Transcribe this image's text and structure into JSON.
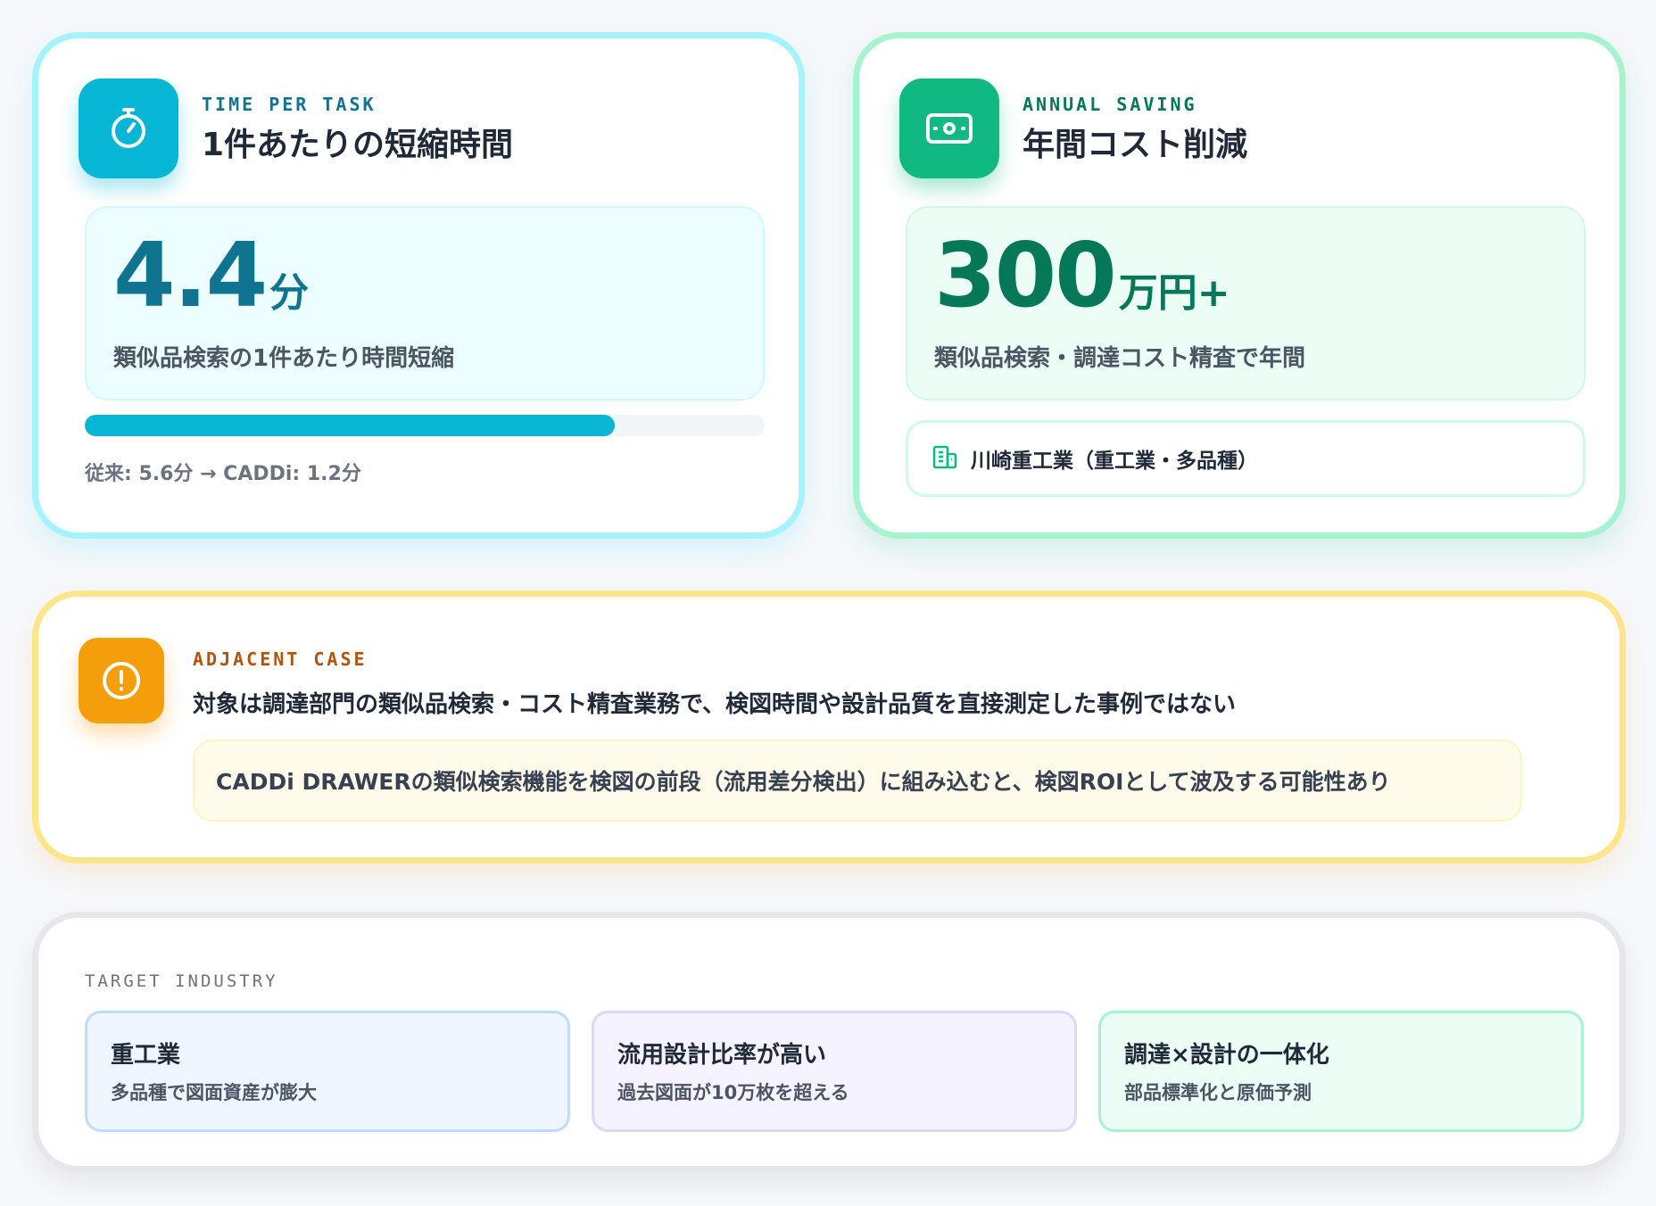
{
  "time_card": {
    "icon": "stopwatch-icon",
    "eyebrow": "TIME PER TASK",
    "title": "1件あたりの短縮時間",
    "value": "4.4",
    "unit": "分",
    "caption": "類似品検索の1件あたり時間短縮",
    "progress": 0.78,
    "note": "従来: 5.6分 → CADDi: 1.2分",
    "accent": "#06b6d4",
    "value_color": "#0e7490"
  },
  "saving_card": {
    "icon": "banknote-icon",
    "eyebrow": "ANNUAL SAVING",
    "title": "年間コスト削減",
    "value": "300",
    "unit": "万円+",
    "caption": "類似品検索・調達コスト精査で年間",
    "company_icon": "building-icon",
    "company": "川崎重工業（重工業・多品種）",
    "accent": "#10b981",
    "value_color": "#047857"
  },
  "adjacent_card": {
    "icon": "alert-circle-icon",
    "eyebrow": "ADJACENT CASE",
    "title": "対象は調達部門の類似品検索・コスト精査業務で、検図時間や設計品質を直接測定した事例ではない",
    "note": "CADDi DRAWERの類似検索機能を検図の前段（流用差分検出）に組み込むと、検図ROIとして波及する可能性あり",
    "accent": "#f59e0b",
    "eyebrow_color": "#b45309"
  },
  "target_card": {
    "label": "TARGET INDUSTRY",
    "items": [
      {
        "title": "重工業",
        "sub": "多品種で図面資産が膨大",
        "bg": "#eff6ff",
        "border": "#bfdbfe"
      },
      {
        "title": "流用設計比率が高い",
        "sub": "過去図面が10万枚を超える",
        "bg": "#f5f3ff",
        "border": "#ddd6fe"
      },
      {
        "title": "調達×設計の一体化",
        "sub": "部品標準化と原価予測",
        "bg": "#ecfdf5",
        "border": "#a7f3d0"
      }
    ]
  }
}
